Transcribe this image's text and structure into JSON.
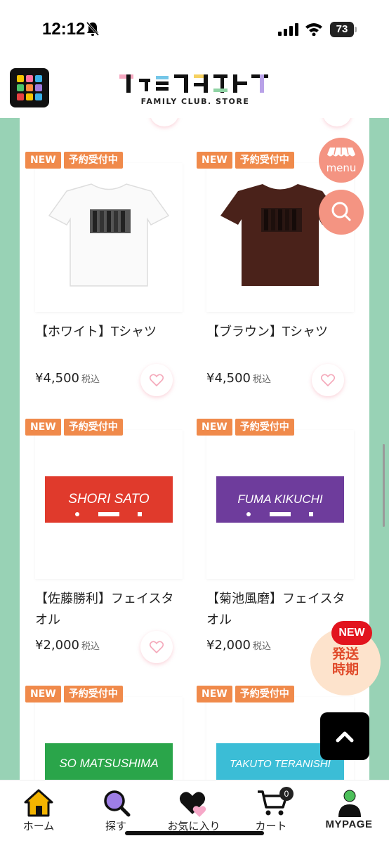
{
  "status_bar": {
    "time": "12:12",
    "battery": "73"
  },
  "header": {
    "logo_text": "ファミクラストア",
    "logo_sub": "FAMILY CLUB. STORE"
  },
  "badges": {
    "new": "NEW",
    "preorder": "予約受付中"
  },
  "products": [
    {
      "name": "【ホワイト】Tシャツ",
      "price": "¥4,500",
      "tax": "税込",
      "image_text": ""
    },
    {
      "name": "【ブラウン】Tシャツ",
      "price": "¥4,500",
      "tax": "税込",
      "image_text": ""
    },
    {
      "name": "【佐藤勝利】フェイスタオル",
      "price": "¥2,000",
      "tax": "税込",
      "image_text": "SHORI SATO"
    },
    {
      "name": "【菊池風磨】フェイスタオル",
      "price": "¥2,000",
      "tax": "税込",
      "image_text": "FUMA KIKUCHI"
    },
    {
      "name": "",
      "price": "",
      "tax": "",
      "image_text": "SO MATSUSHIMA"
    },
    {
      "name": "",
      "price": "",
      "tax": "",
      "image_text": "TAKUTO TERANISHI"
    }
  ],
  "floating": {
    "menu_label": "menu",
    "ship_new": "NEW",
    "ship_label_1": "発送",
    "ship_label_2": "時期"
  },
  "nav": {
    "home": "ホーム",
    "search": "探す",
    "favorites": "お気に入り",
    "cart": "カート",
    "cart_count": "0",
    "mypage": "MYPAGE"
  },
  "colors": {
    "side_green": "#98d2b5",
    "badge_orange": "#f08a4b",
    "fab_salmon": "#f49482",
    "towel_red": "#e03a2c",
    "towel_purple": "#6e3c9c",
    "towel_green": "#2aa54a",
    "towel_cyan": "#3bbdd6"
  }
}
